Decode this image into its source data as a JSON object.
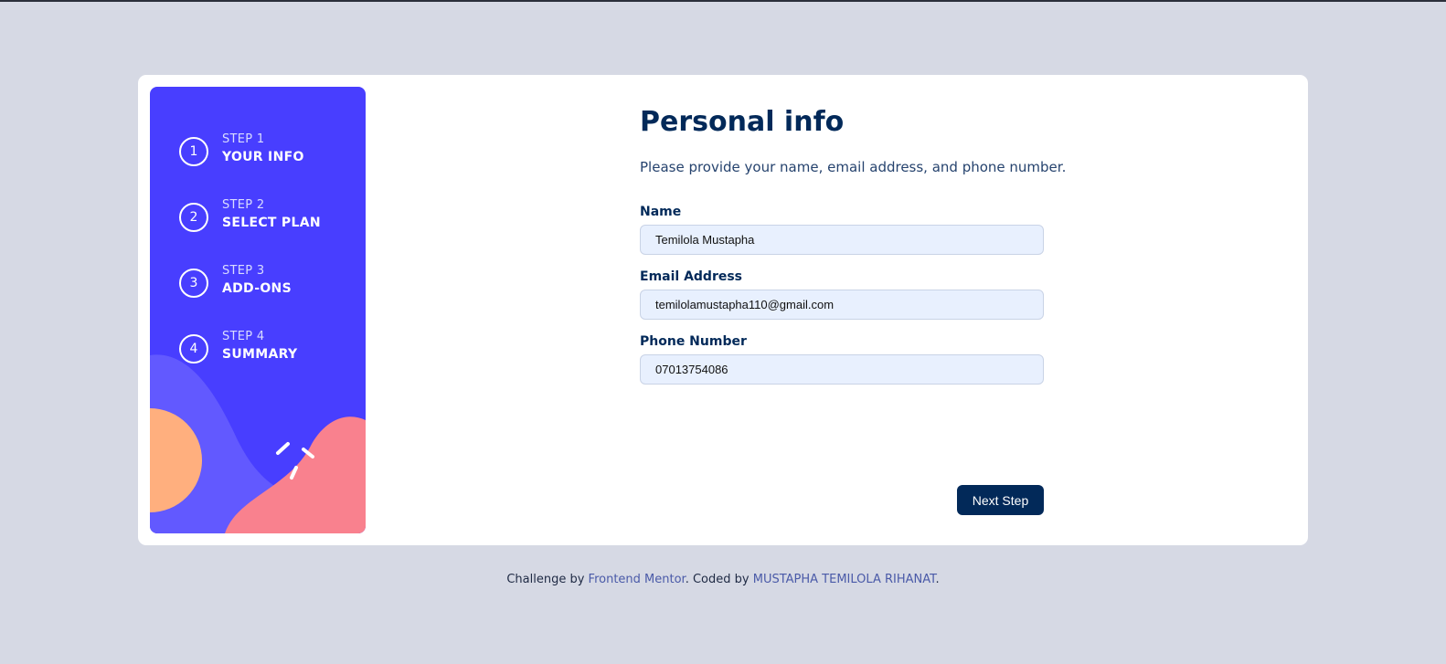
{
  "sidebar": {
    "steps": [
      {
        "number": "1",
        "step": "STEP 1",
        "name": "YOUR INFO"
      },
      {
        "number": "2",
        "step": "STEP 2",
        "name": "SELECT PLAN"
      },
      {
        "number": "3",
        "step": "STEP 3",
        "name": "ADD-ONS"
      },
      {
        "number": "4",
        "step": "STEP 4",
        "name": "SUMMARY"
      }
    ],
    "active_step": 1,
    "colors": {
      "background": "#483eff",
      "blob": "#6259ff",
      "sun": "#ffaf7e",
      "pink": "#f9818e"
    }
  },
  "form": {
    "title": "Personal info",
    "subtitle": "Please provide your name, email address, and phone number.",
    "name": {
      "label": "Name",
      "value": "Temilola Mustapha"
    },
    "email": {
      "label": "Email Address",
      "value": "temilolamustapha110@gmail.com"
    },
    "phone": {
      "label": "Phone Number",
      "value": "07013754086"
    },
    "next_label": "Next Step"
  },
  "footer": {
    "prefix": "Challenge by ",
    "link1": "Frontend Mentor",
    "middle": ". Coded by ",
    "link2": "MUSTAPHA TEMILOLA RIHANAT",
    "suffix": "."
  },
  "colors": {
    "accent": "#483eff",
    "text_dark": "#022959",
    "page_bg": "#d6d9e4"
  }
}
